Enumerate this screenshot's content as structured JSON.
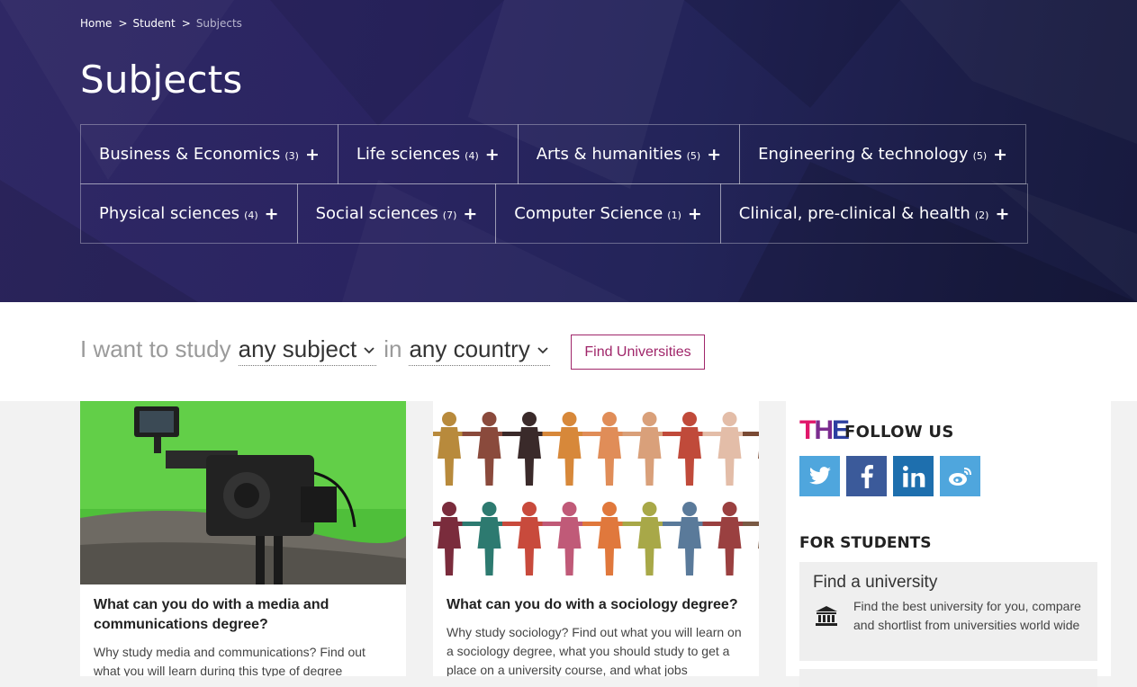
{
  "breadcrumb": {
    "items": [
      "Home",
      "Student",
      "Subjects"
    ],
    "separator": ">"
  },
  "page_title": "Subjects",
  "subjects_row1": [
    {
      "label": "Business & Economics",
      "count": "(3)",
      "icon": "plus-icon"
    },
    {
      "label": "Life sciences",
      "count": "(4)",
      "icon": "plus-icon"
    },
    {
      "label": "Arts & humanities",
      "count": "(5)",
      "icon": "plus-icon"
    },
    {
      "label": "Engineering & technology",
      "count": "(5)",
      "icon": "plus-icon"
    }
  ],
  "subjects_row2": [
    {
      "label": "Physical sciences",
      "count": "(4)",
      "icon": "plus-icon"
    },
    {
      "label": "Social sciences",
      "count": "(7)",
      "icon": "plus-icon"
    },
    {
      "label": "Computer Science",
      "count": "(1)",
      "icon": "plus-icon"
    },
    {
      "label": "Clinical, pre-clinical & health",
      "count": "(2)",
      "icon": "plus-icon"
    }
  ],
  "search": {
    "prefix": "I want to study",
    "subject_value": "any subject",
    "joiner": "in",
    "country_value": "any country",
    "button_label": "Find Universities"
  },
  "cards": [
    {
      "title": "What can you do with a media and communications degree?",
      "excerpt": "Why study media and communications? Find out what you will learn during this type of degree",
      "image": "film-camera-green-screen-photo"
    },
    {
      "title": "What can you do with a sociology degree?",
      "excerpt": "Why study sociology? Find out what you will learn on a sociology degree, what you should study to get a place on a university course, and what jobs",
      "image": "paper-people-chain-photo"
    }
  ],
  "sidebar": {
    "logo_text": "THE",
    "follow_label": "FOLLOW US",
    "social": [
      {
        "name": "twitter-icon",
        "color": "#4fa6dd"
      },
      {
        "name": "facebook-icon",
        "color": "#3b5a9a"
      },
      {
        "name": "linkedin-icon",
        "color": "#1e6fae"
      },
      {
        "name": "weibo-icon",
        "color": "#4fa6dd"
      }
    ],
    "students_label": "FOR STUDENTS",
    "find_title": "Find a university",
    "find_desc": "Find the best university for you, compare and shortlist from universities world wide"
  },
  "colors": {
    "accent": "#a0266a",
    "hero_dark": "#1b1d46",
    "hero_purple": "#2f2865"
  }
}
